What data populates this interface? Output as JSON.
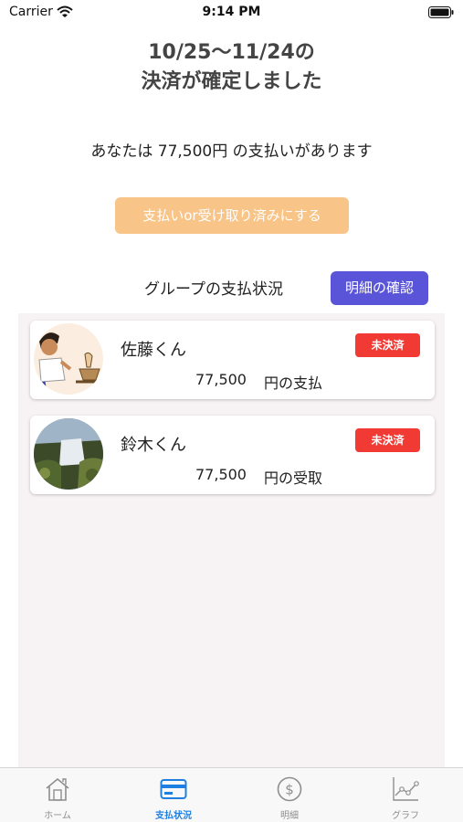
{
  "status_bar": {
    "carrier": "Carrier",
    "time": "9:14 PM"
  },
  "header": {
    "title_line1": "10/25〜11/24の",
    "title_line2": "決済が確定しました",
    "amount_text": "あなたは 77,500円 の支払いがあります"
  },
  "settle_button": {
    "label": "支払いor受け取り済みにする",
    "color": "#f8c487"
  },
  "group_section": {
    "label": "グループの支払状況",
    "detail_button_label": "明細の確認",
    "detail_button_color": "#5a55d8"
  },
  "members": [
    {
      "name": "佐藤くん",
      "status": "未決済",
      "amount": "77,500",
      "suffix": "円の支払",
      "avatar": "cartoon-avatar"
    },
    {
      "name": "鈴木くん",
      "status": "未決済",
      "amount": "77,500",
      "suffix": "円の受取",
      "avatar": "waterfall-photo-avatar"
    }
  ],
  "status_color": "#f03a33",
  "tab_bar": {
    "tabs": [
      {
        "label": "ホーム",
        "icon": "home-icon",
        "active": false
      },
      {
        "label": "支払状況",
        "icon": "card-icon",
        "active": true
      },
      {
        "label": "明細",
        "icon": "dollar-icon",
        "active": false
      },
      {
        "label": "グラフ",
        "icon": "chart-icon",
        "active": false
      }
    ],
    "active_color": "#1e7fe0"
  }
}
